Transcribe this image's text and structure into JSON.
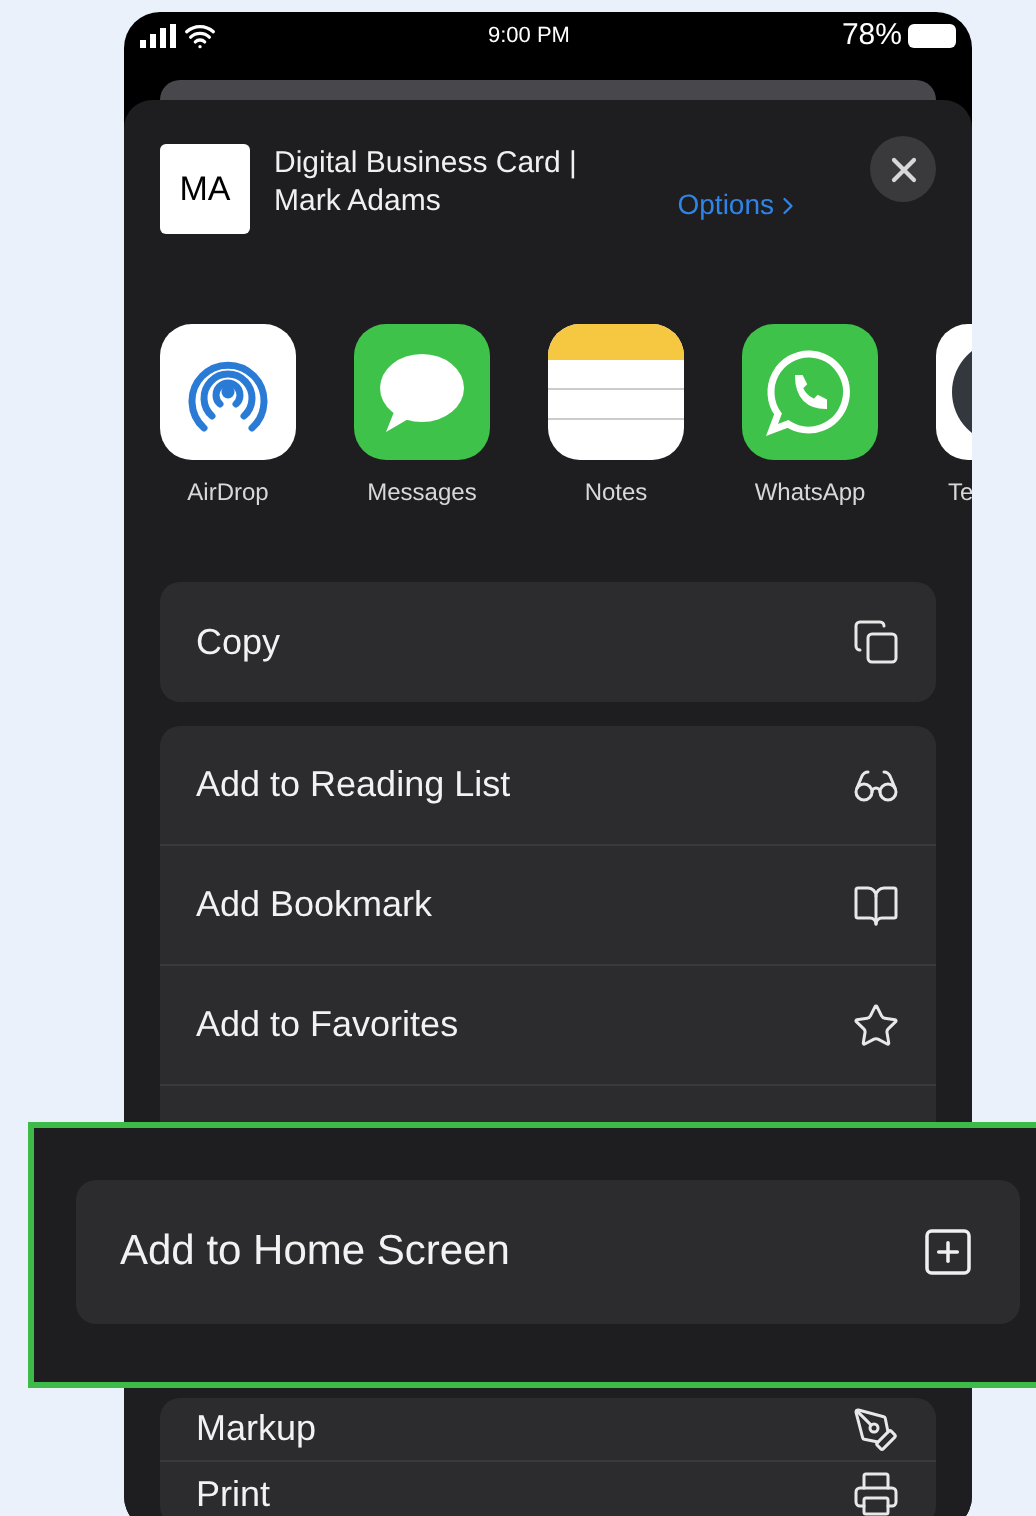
{
  "status_bar": {
    "time": "9:00 PM",
    "battery": "78%"
  },
  "share_header": {
    "avatar": "MA",
    "title": "Digital Business Card |",
    "subtitle": "Mark Adams",
    "options": "Options"
  },
  "apps": [
    {
      "label": "AirDrop",
      "kind": "airdrop"
    },
    {
      "label": "Messages",
      "kind": "messages"
    },
    {
      "label": "Notes",
      "kind": "notes"
    },
    {
      "label": "WhatsApp",
      "kind": "whatsapp"
    },
    {
      "label": "Te",
      "kind": "partial"
    }
  ],
  "action_groups": [
    [
      {
        "label": "Copy",
        "kind": "copy"
      }
    ],
    [
      {
        "label": "Add to Reading List",
        "kind": "glasses"
      },
      {
        "label": "Add Bookmark",
        "kind": "book"
      },
      {
        "label": "Add to Favorites",
        "kind": "star"
      },
      {
        "kind": "hidden"
      }
    ],
    [
      {
        "label": "Markup",
        "kind": "markup"
      },
      {
        "label": "Print",
        "kind": "print"
      }
    ]
  ],
  "callout": {
    "label": "Add to Home Screen",
    "kind": "add"
  }
}
